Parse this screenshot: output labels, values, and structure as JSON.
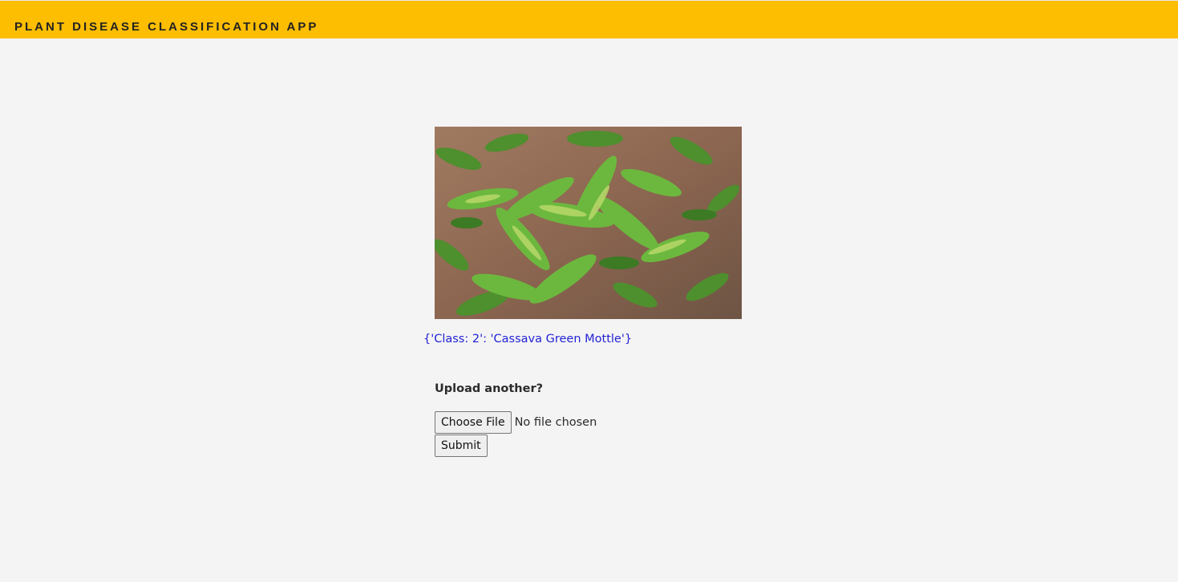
{
  "header": {
    "title": "PLANT DISEASE CLASSIFICATION APP",
    "background_color": "#fdbd00"
  },
  "main": {
    "image_description_icon": "plant-photo",
    "result_text": "{'Class: 2': 'Cassava Green Mottle'}",
    "result_color": "#2323d6",
    "upload_label": "Upload another?",
    "choose_file_label": "Choose File",
    "file_status": "No file chosen",
    "submit_label": "Submit"
  }
}
